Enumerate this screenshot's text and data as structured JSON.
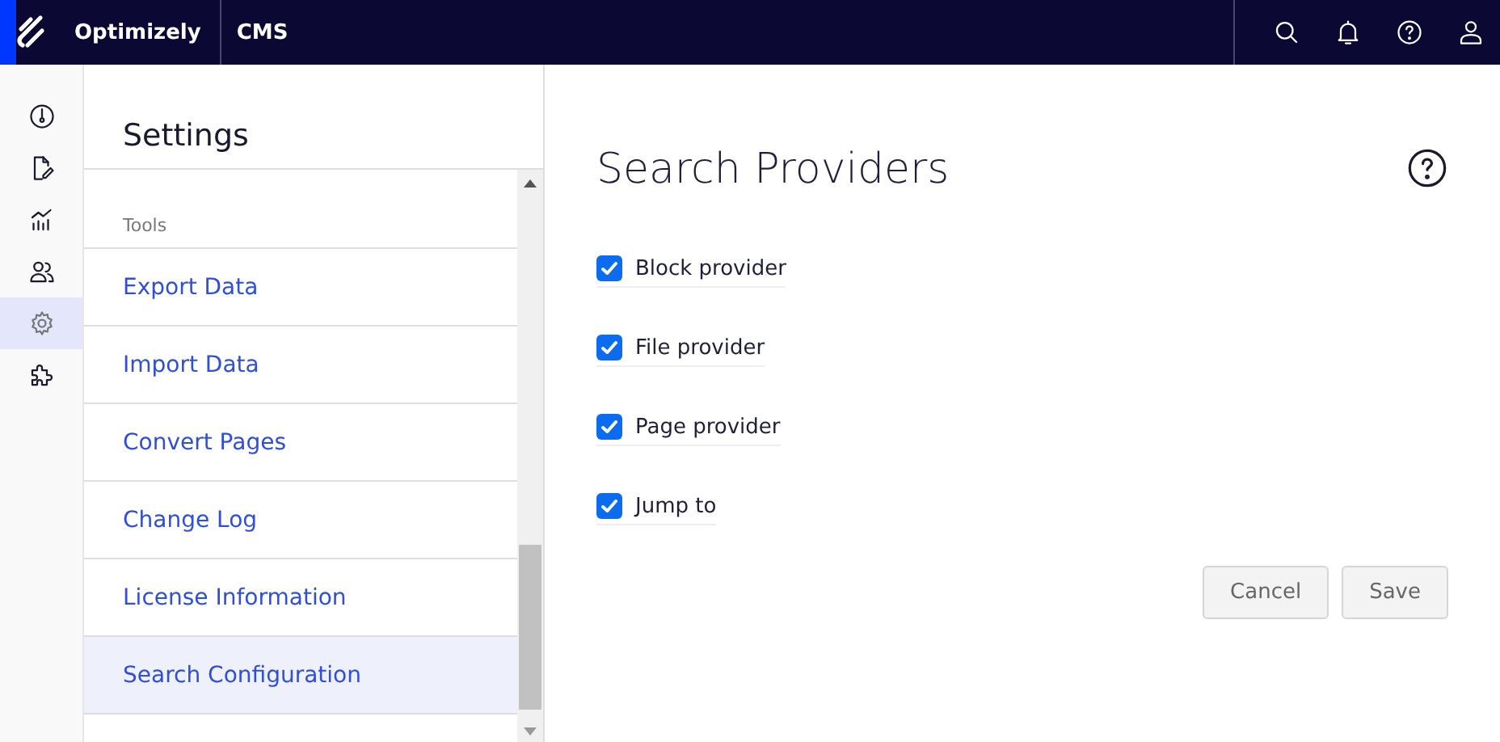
{
  "top_bar": {
    "brand": "Optimizely",
    "product": "CMS"
  },
  "nav_rail": [
    {
      "kind": "dashboard",
      "selected": false
    },
    {
      "kind": "edit",
      "selected": false
    },
    {
      "kind": "chart",
      "selected": false
    },
    {
      "kind": "users",
      "selected": false
    },
    {
      "kind": "settings",
      "selected": true
    },
    {
      "kind": "addons",
      "selected": false
    }
  ],
  "settings": {
    "title": "Settings",
    "section": "Tools",
    "items": [
      {
        "label": "Export Data",
        "selected": false
      },
      {
        "label": "Import Data",
        "selected": false
      },
      {
        "label": "Convert Pages",
        "selected": false
      },
      {
        "label": "Change Log",
        "selected": false
      },
      {
        "label": "License Information",
        "selected": false
      },
      {
        "label": "Search Configuration",
        "selected": true
      }
    ]
  },
  "main": {
    "title": "Search Providers",
    "providers": [
      {
        "label": "Block provider",
        "checked": true
      },
      {
        "label": "File provider",
        "checked": true
      },
      {
        "label": "Page provider",
        "checked": true
      },
      {
        "label": "Jump to",
        "checked": true
      }
    ],
    "buttons": [
      "Cancel",
      "Save"
    ]
  }
}
